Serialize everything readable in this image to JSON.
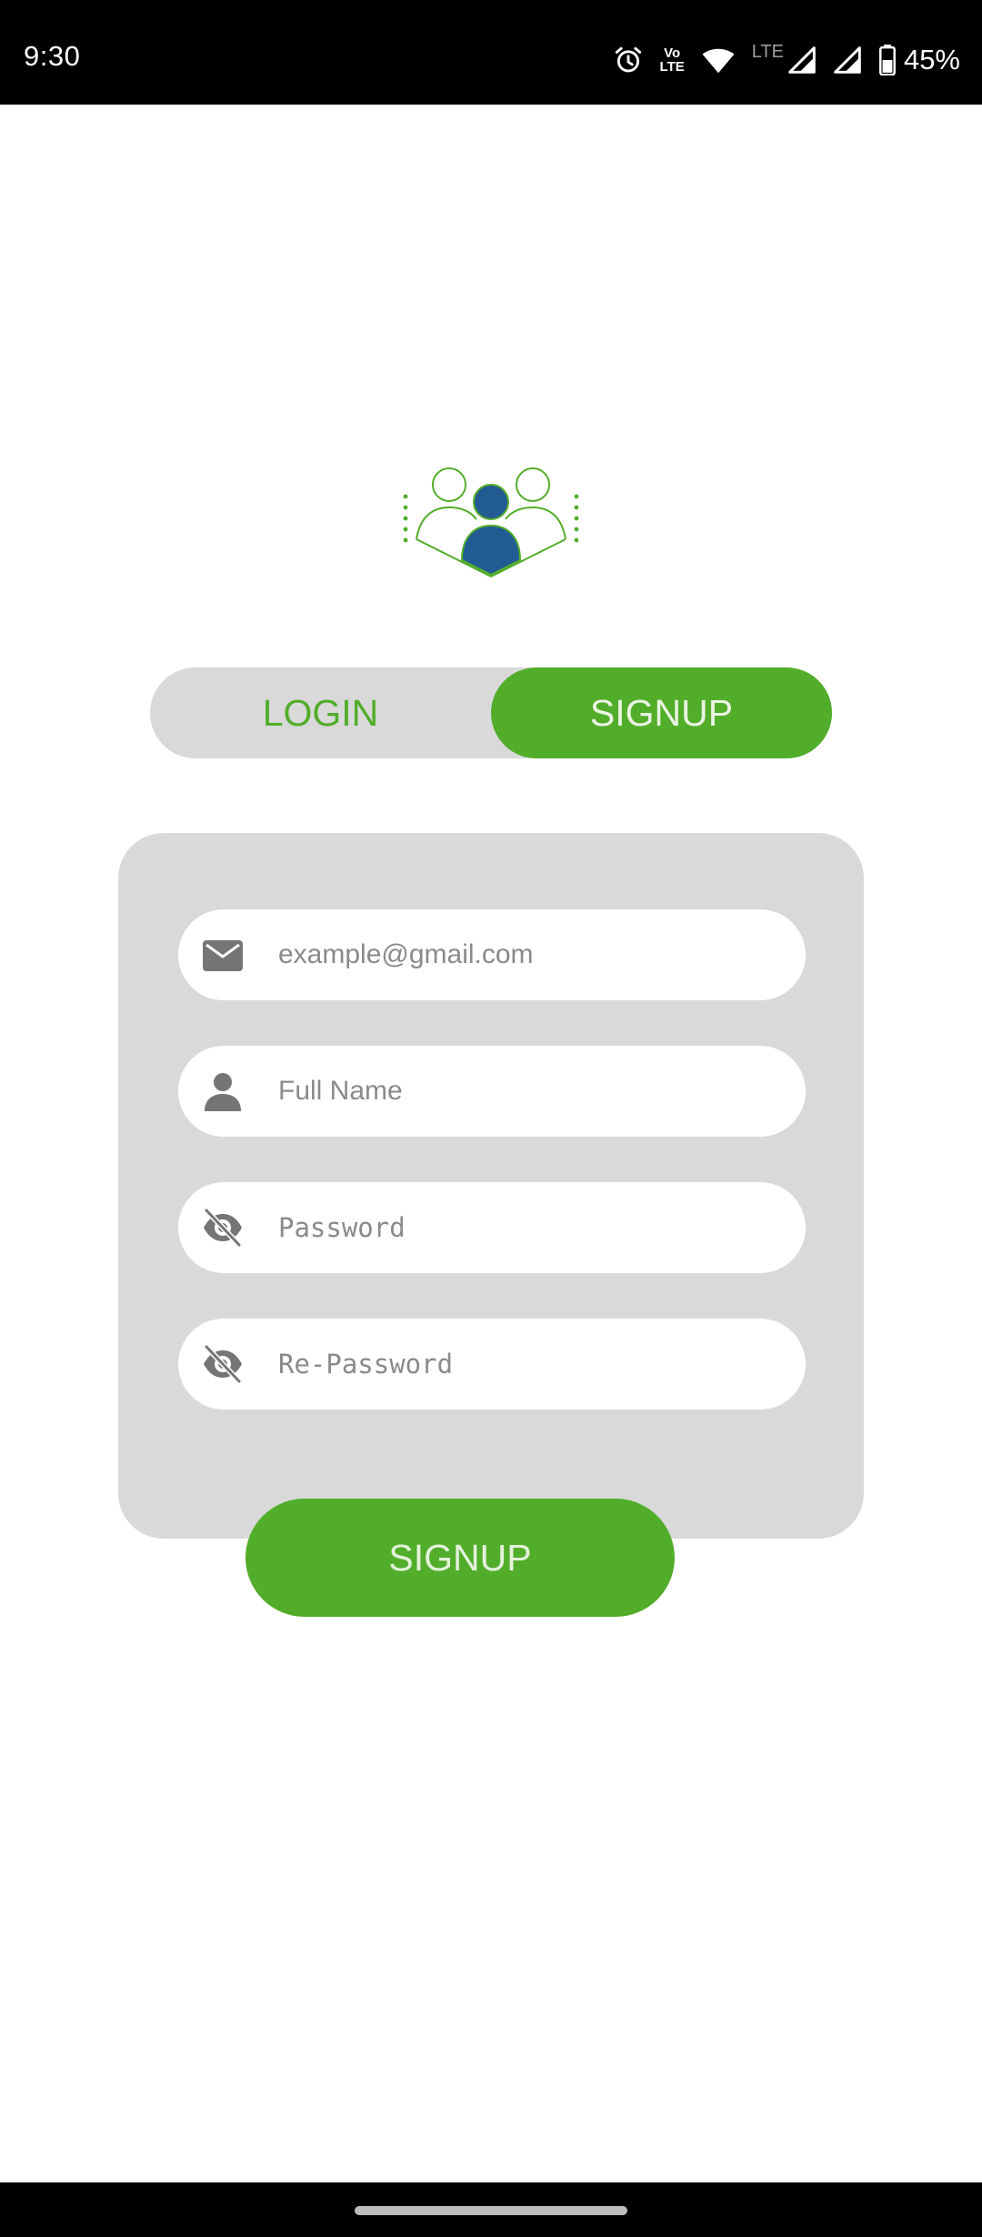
{
  "status_bar": {
    "time": "9:30",
    "volte_line1": "Vo",
    "volte_line2": "LTE",
    "lte_label": "LTE",
    "battery_percent": "45%",
    "icons": [
      "alarm-icon",
      "volte-icon",
      "wifi-icon",
      "signal-icon",
      "signal-icon",
      "battery-icon"
    ]
  },
  "logo": {
    "icon": "users-group-icon",
    "colors": {
      "outline": "#52ad2a",
      "fill": "#225b92"
    }
  },
  "auth_toggle": {
    "login_label": "LOGIN",
    "signup_label": "SIGNUP",
    "active": "SIGNUP"
  },
  "form": {
    "email": {
      "placeholder": "example@gmail.com",
      "value": "",
      "icon": "mail-icon"
    },
    "full_name": {
      "placeholder": "Full Name",
      "value": "",
      "icon": "person-icon"
    },
    "password": {
      "placeholder": "Password",
      "value": "",
      "icon": "eye-off-icon"
    },
    "re_password": {
      "placeholder": "Re-Password",
      "value": "",
      "icon": "eye-off-icon"
    }
  },
  "submit": {
    "label": "SIGNUP"
  },
  "colors": {
    "accent": "#52ad2a",
    "card_bg": "#d9d9d9",
    "icon_gray": "#757575",
    "brand_blue": "#225b92"
  }
}
